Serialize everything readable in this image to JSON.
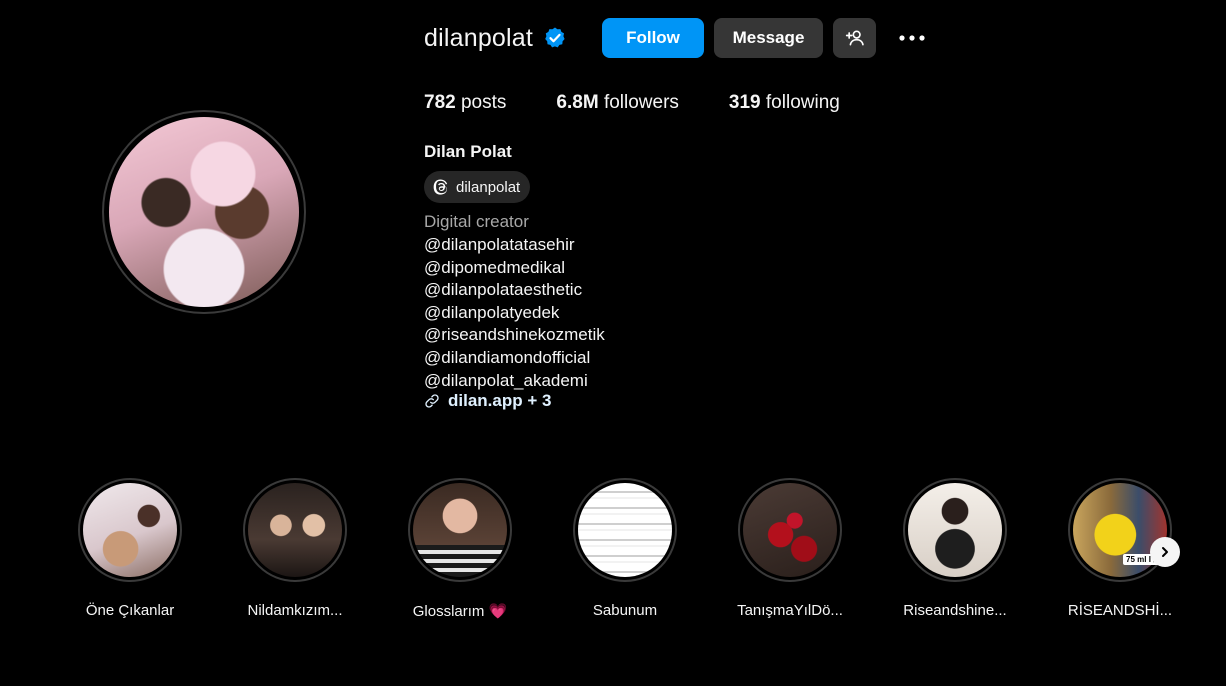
{
  "profile": {
    "username": "dilanpolat",
    "verified_icon": "verified-badge-icon",
    "follow_label": "Follow",
    "message_label": "Message",
    "add_user_icon": "add-user-icon",
    "more_icon": "more-horizontal-icon",
    "full_name": "Dilan Polat",
    "threads_handle": "dilanpolat",
    "threads_icon": "threads-icon",
    "category": "Digital creator",
    "bio_lines": [
      "@dilanpolatatasehir",
      "@dipomedmedikal",
      "@dilanpolataesthetic",
      "@dilanpolatyedek",
      "@riseandshinekozmetik",
      "@dilandiamondofficial",
      "@dilanpolat_akademi"
    ],
    "link_icon": "link-icon",
    "link_text": "dilan.app + 3"
  },
  "stats": {
    "posts_count": "782",
    "posts_label": "posts",
    "followers_count": "6.8M",
    "followers_label": "followers",
    "following_count": "319",
    "following_label": "following"
  },
  "highlights": [
    {
      "label": "Öne Çıkanlar"
    },
    {
      "label": "Nildamkızım..."
    },
    {
      "label": "Glosslarım 💗"
    },
    {
      "label": "Sabunum"
    },
    {
      "label": "TanışmaYılDö..."
    },
    {
      "label": "Riseandshine..."
    },
    {
      "label": "RİSEANDSHİ..."
    }
  ],
  "highlight_overlay_text": "75 ml I ⌀",
  "colors": {
    "background": "#000000",
    "follow_button": "#0095f6",
    "secondary_button": "#363636",
    "verified": "#0095f6",
    "muted_text": "#a8a8a8"
  }
}
